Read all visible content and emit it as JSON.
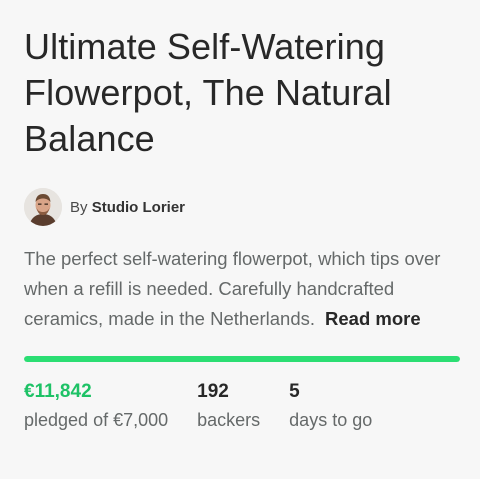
{
  "project": {
    "title": "Ultimate Self-Watering Flowerpot, The Natural Balance",
    "by_prefix": "By",
    "creator": "Studio Lorier",
    "blurb": "The perfect self-watering flowerpot, which tips over when a refill is needed. Carefully handcrafted ceramics, made in the Netherlands.",
    "read_more": "Read more"
  },
  "funding": {
    "progress_percent": 100,
    "pledged": "€11,842",
    "pledged_label": "pledged of €7,000",
    "backers": "192",
    "backers_label": "backers",
    "days": "5",
    "days_label": "days to go"
  },
  "colors": {
    "accent": "#2bde73",
    "pledged_text": "#1ec266",
    "title_text": "#282828",
    "body_text": "#656969"
  },
  "icons": {
    "avatar": "creator-avatar-photo"
  }
}
